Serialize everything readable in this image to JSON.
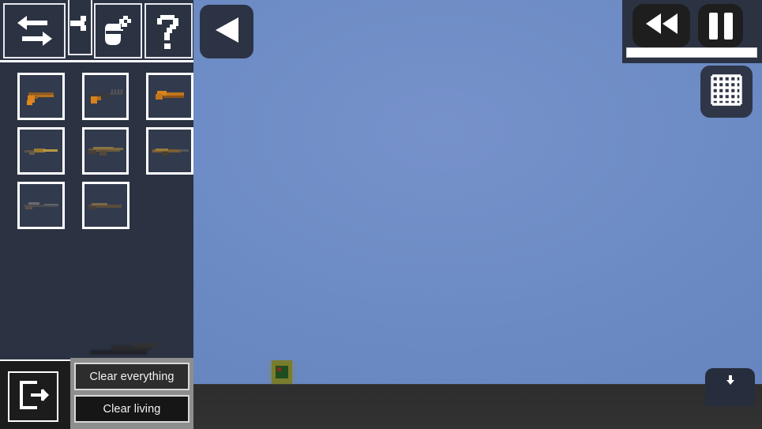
{
  "app": {
    "title": "Sandbox Weapon Spawner",
    "sky_color": "#6b8ac3",
    "ground_color": "#2f2f2f",
    "panel_color": "#2b3343",
    "accent_color": "#ffffff"
  },
  "sidebar": {
    "toolbar": [
      {
        "name": "swap-tool",
        "icon": "swap-arrows-icon",
        "label": "Swap"
      },
      {
        "name": "next-tool",
        "icon": "arrow-right-icon",
        "label": "Next"
      },
      {
        "name": "grenade-tool",
        "icon": "grenade-icon",
        "label": "Grenade"
      },
      {
        "name": "help-tool",
        "icon": "question-mark-icon",
        "label": "Help"
      }
    ],
    "items": [
      {
        "name": "weapon-pistol",
        "icon": "pistol-icon",
        "label": "Pistol"
      },
      {
        "name": "weapon-smg",
        "icon": "smg-icon",
        "label": "SMG"
      },
      {
        "name": "weapon-sawnoff",
        "icon": "sawn-off-icon",
        "label": "Sawn-off"
      },
      {
        "name": "weapon-rifle",
        "icon": "rifle-icon",
        "label": "Rifle"
      },
      {
        "name": "weapon-carbine",
        "icon": "carbine-icon",
        "label": "Carbine"
      },
      {
        "name": "weapon-ak",
        "icon": "assault-rifle-icon",
        "label": "Assault Rifle"
      },
      {
        "name": "weapon-sniper",
        "icon": "sniper-icon",
        "label": "Sniper"
      },
      {
        "name": "weapon-shotgun",
        "icon": "shotgun-icon",
        "label": "Shotgun"
      }
    ],
    "exit_button": {
      "icon": "exit-door-icon",
      "label": "Exit"
    }
  },
  "clear_menu": {
    "clear_everything": "Clear everything",
    "clear_living": "Clear living"
  },
  "hud": {
    "back_button": {
      "icon": "play-left-triangle-icon",
      "label": "Back"
    },
    "rewind_button": {
      "icon": "rewind-icon",
      "label": "Rewind"
    },
    "pause_button": {
      "icon": "pause-icon",
      "label": "Pause"
    },
    "timeline": {
      "name": "timeline-slider",
      "value": 100
    },
    "grid_toggle": {
      "icon": "grid-icon",
      "label": "Grid"
    },
    "download_panel": {
      "icon": "download-icon",
      "label": "Download"
    }
  },
  "world": {
    "actor": {
      "name": "spawned-entity",
      "label": "Entity"
    }
  }
}
